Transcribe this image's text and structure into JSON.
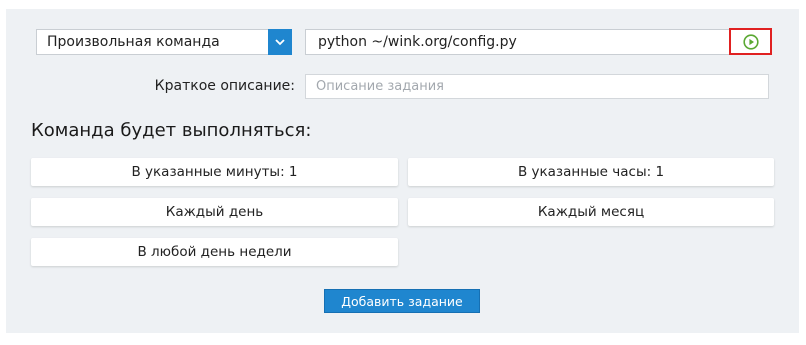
{
  "command_type": {
    "selected": "Произвольная команда",
    "icon": "chevron-down-icon"
  },
  "command": {
    "value": "python ~/wink.org/config.py",
    "run_icon": "play-circle-icon",
    "run_icon_color": "#5aa832",
    "highlight_color": "#e02121"
  },
  "description": {
    "label": "Краткое описание:",
    "placeholder": "Описание задания"
  },
  "schedule": {
    "heading": "Команда будет выполняться:",
    "minutes": "В указанные минуты: 1",
    "hours": "В указанные часы: 1",
    "daily": "Каждый день",
    "monthly": "Каждый месяц",
    "weekday": "В любой день недели"
  },
  "actions": {
    "add_label": "Добавить задание",
    "accent": "#1f86cf"
  }
}
